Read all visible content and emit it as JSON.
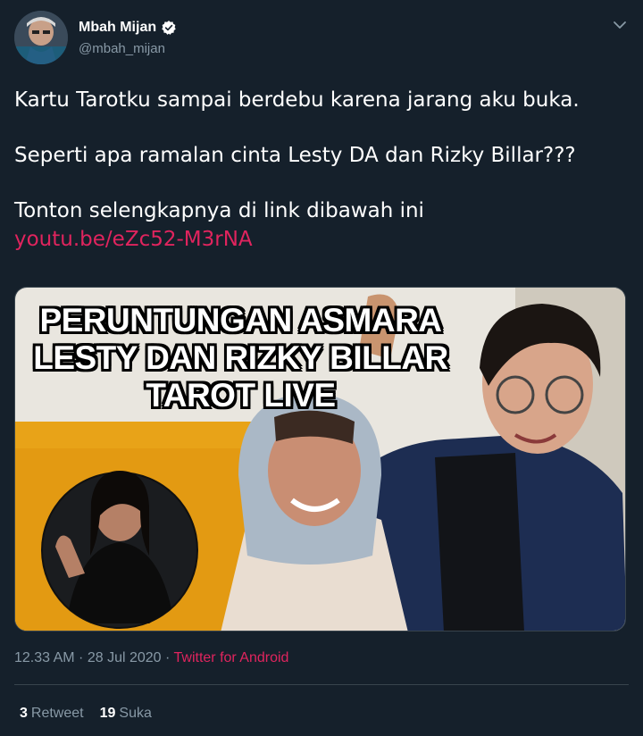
{
  "user": {
    "display_name": "Mbah Mijan",
    "handle": "@mbah_mijan",
    "verified": true
  },
  "tweet": {
    "lines": [
      "Kartu Tarotku sampai berdebu karena jarang aku buka.",
      "Seperti apa ramalan cinta Lesty DA dan Rizky Billar???",
      "Tonton selengkapnya di link dibawah ini"
    ],
    "link": "youtu.be/eZc52-M3rNA"
  },
  "media": {
    "overlay_lines": [
      "PERUNTUNGAN ASMARA",
      "LESTY DAN RIZKY BILLAR",
      "TAROT LIVE"
    ]
  },
  "meta": {
    "time": "12.33 AM",
    "separator": " · ",
    "date": "28 Jul 2020",
    "separator2": " · ",
    "source": "Twitter for Android"
  },
  "stats": {
    "retweet_count": "3",
    "retweet_label": "Retweet",
    "like_count": "19",
    "like_label": "Suka"
  },
  "colors": {
    "background": "#15202b",
    "link": "#e0245e",
    "secondary_text": "#8899a6",
    "verified": "#ffffff"
  }
}
